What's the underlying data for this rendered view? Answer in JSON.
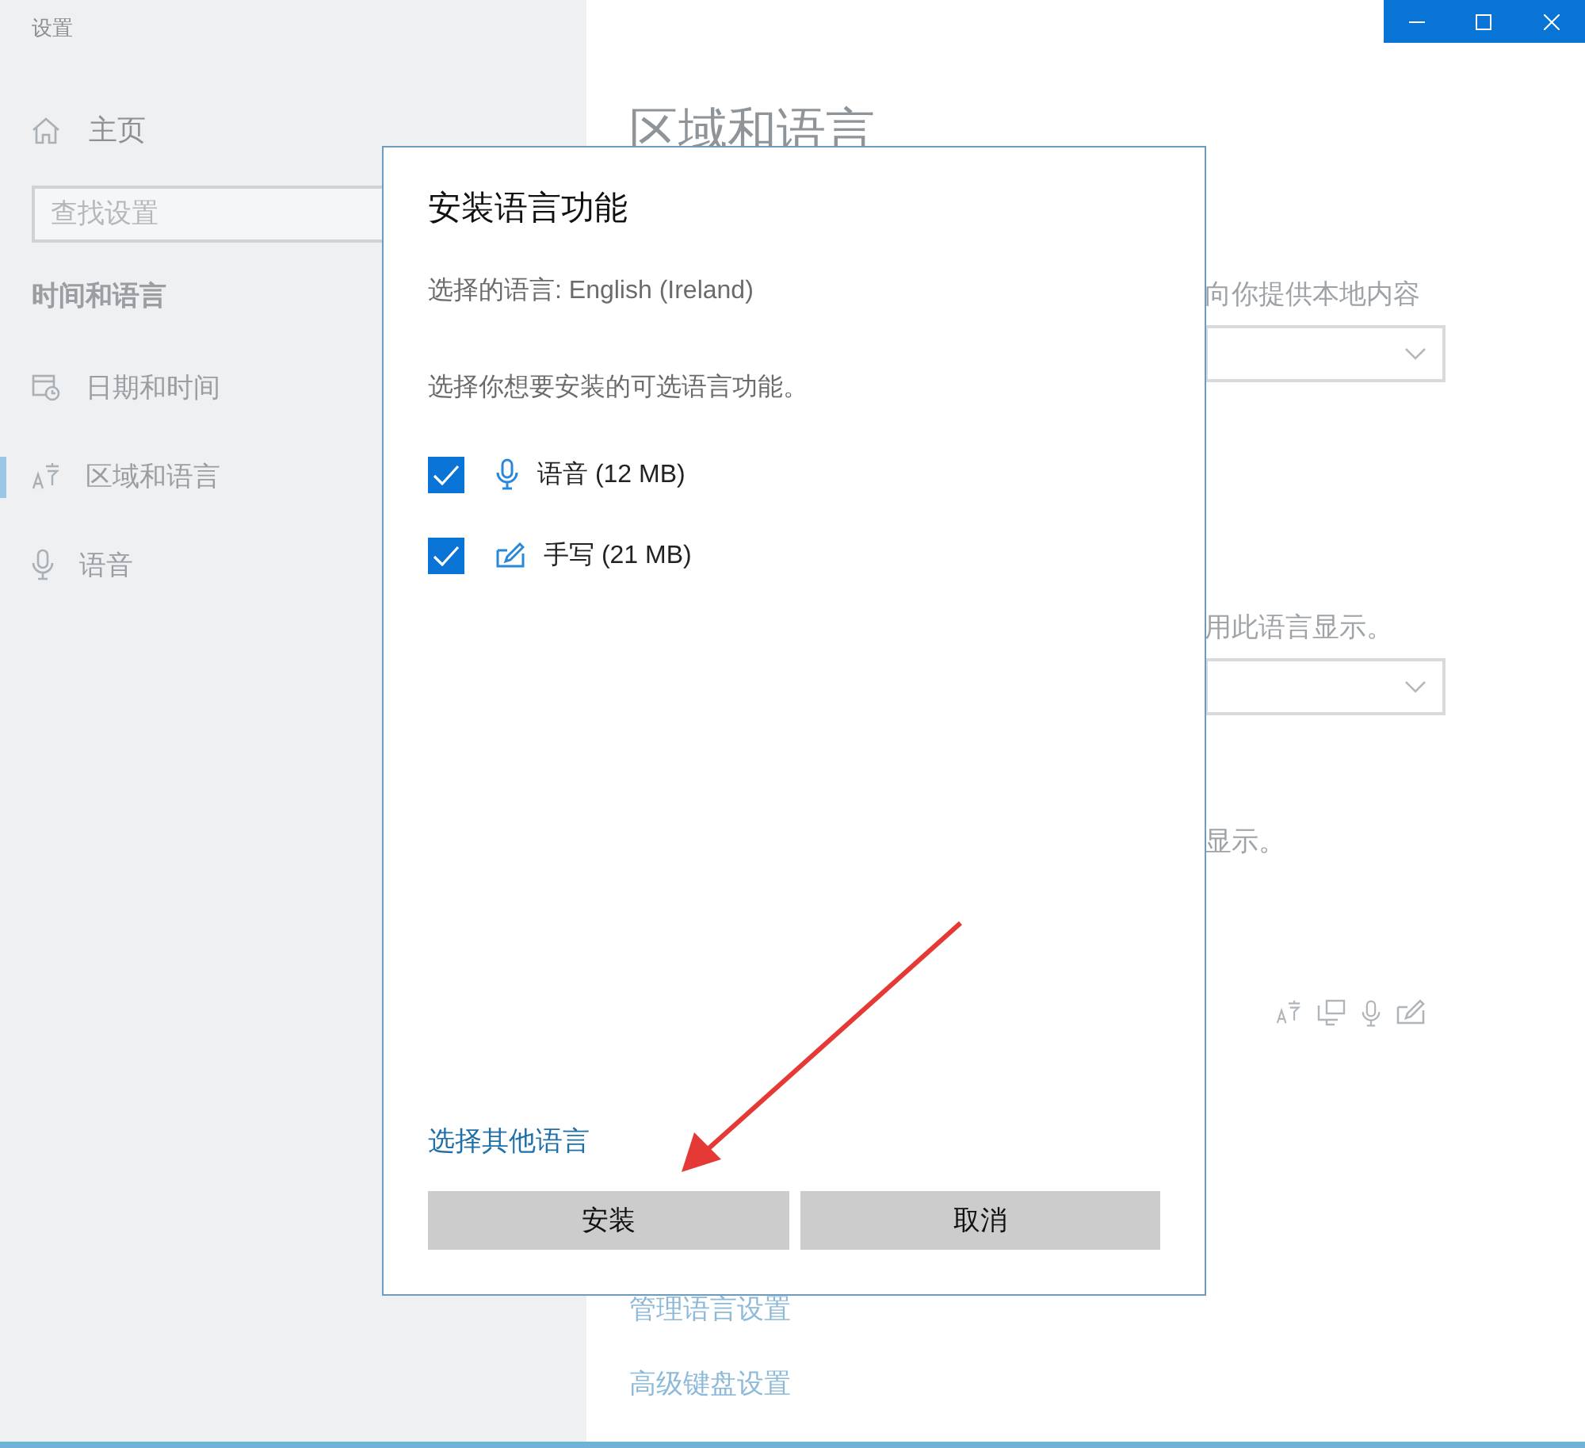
{
  "window": {
    "title": "设置"
  },
  "sidebar": {
    "home": "主页",
    "search": {
      "placeholder": "查找设置"
    },
    "section": "时间和语言",
    "items": [
      {
        "label": "日期和时间",
        "selected": false
      },
      {
        "label": "区域和语言",
        "selected": true
      },
      {
        "label": "语音",
        "selected": false
      }
    ]
  },
  "page": {
    "title": "区域和语言",
    "region_hint": "向你提供本地内容",
    "display_hint": "用此语言显示。",
    "display_hint_2": "显示。",
    "links": [
      "管理语言设置",
      "高级键盘设置"
    ]
  },
  "dialog": {
    "title": "安装语言功能",
    "selected_language": "选择的语言: English (Ireland)",
    "prompt": "选择你想要安装的可选语言功能。",
    "features": [
      {
        "label": "语音 (12 MB)",
        "checked": true,
        "kind": "speech"
      },
      {
        "label": "手写 (21 MB)",
        "checked": true,
        "kind": "handwriting"
      }
    ],
    "link": "选择其他语言",
    "buttons": [
      "安装",
      "取消"
    ]
  }
}
